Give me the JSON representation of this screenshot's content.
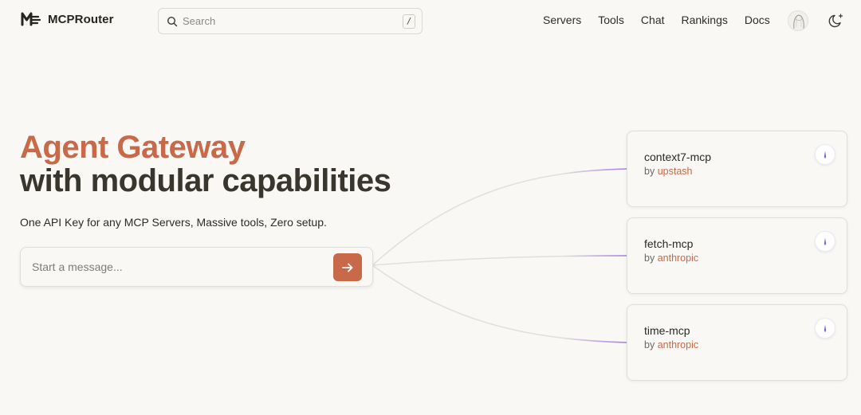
{
  "brand": {
    "name": "MCPRouter",
    "icon": "mcp-logo-icon"
  },
  "search": {
    "placeholder": "Search",
    "shortcut": "/"
  },
  "nav": {
    "links": [
      {
        "label": "Servers"
      },
      {
        "label": "Tools"
      },
      {
        "label": "Chat"
      },
      {
        "label": "Rankings"
      },
      {
        "label": "Docs"
      }
    ],
    "theme_icon": "moon-icon",
    "avatar_icon": "user-avatar"
  },
  "hero": {
    "title_accent": "Agent Gateway",
    "title_main": "with modular capabilities",
    "subtitle": "One API Key for any MCP Servers, Massive tools, Zero setup."
  },
  "chat": {
    "placeholder": "Start a message...",
    "send_icon": "arrow-right-icon"
  },
  "servers": [
    {
      "name": "context7-mcp",
      "by_label": "by",
      "author": "upstash",
      "icon": "server-badge-icon"
    },
    {
      "name": "fetch-mcp",
      "by_label": "by",
      "author": "anthropic",
      "icon": "server-badge-icon"
    },
    {
      "name": "time-mcp",
      "by_label": "by",
      "author": "anthropic",
      "icon": "server-badge-icon"
    }
  ],
  "colors": {
    "accent": "#c8694a",
    "background": "#f9f8f5",
    "heading_dark": "#38362d",
    "connector_purple": "#a57de8"
  }
}
